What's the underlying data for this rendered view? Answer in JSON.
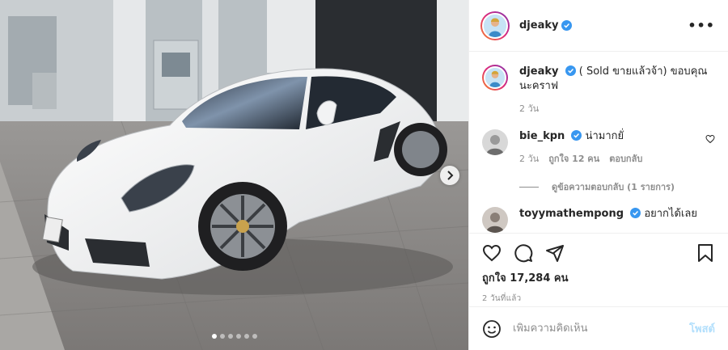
{
  "post": {
    "author": "djeaky",
    "more_glyph": "•••",
    "caption": {
      "username": "djeaky",
      "text": "( Sold ขายแล้วจ้า) ขอบคุณนะคราฟ",
      "age": "2 วัน"
    },
    "comments": [
      {
        "username": "bie_kpn",
        "text": "น่ามากยั่",
        "age": "2 วัน",
        "likes": "ถูกใจ 12 คน",
        "reply_label": "ตอบกลับ",
        "view_replies": "ดูข้อความตอบกลับ (1 รายการ)"
      },
      {
        "username": "toyymathempong",
        "text": "อยากได้เลย"
      }
    ],
    "likes_text": "ถูกใจ 17,284 คน",
    "timestamp": "2 วันที่แล้ว",
    "composer": {
      "placeholder": "เพิ่มความคิดเห็น",
      "post_label": "โพสต์"
    },
    "carousel": {
      "total": 6,
      "active": 1
    }
  },
  "icons": {
    "verified": "verified-badge-icon",
    "heart": "heart-icon",
    "comment": "comment-icon",
    "share": "share-icon",
    "save": "bookmark-icon",
    "emoji": "emoji-icon",
    "next": "chevron-right-icon"
  },
  "colors": {
    "verified_blue": "#3897f0",
    "post_button_disabled": "#b2dffc",
    "secondary_text": "#8e8e8e"
  }
}
